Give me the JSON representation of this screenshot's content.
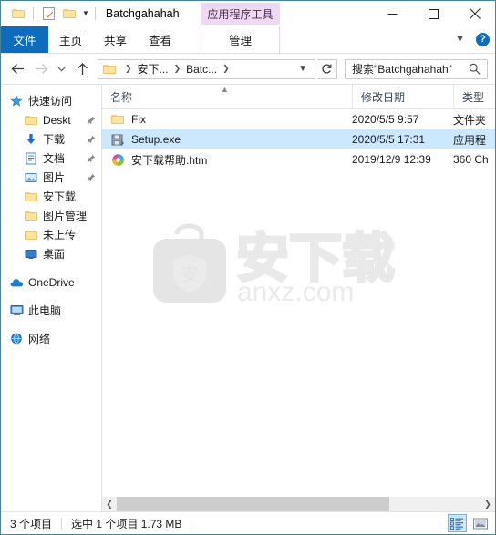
{
  "window": {
    "title": "Batchgahahah",
    "contextual_tab_group": "应用程序工具",
    "quick_access": [
      {
        "name": "folder-icon",
        "label": "属性文件夹"
      },
      {
        "name": "properties-icon",
        "label": "属性"
      },
      {
        "name": "new-folder-icon",
        "label": "新建文件夹"
      },
      {
        "name": "customize-caret",
        "label": "自定义快速访问工具栏"
      }
    ],
    "controls": {
      "minimize": "最小化",
      "maximize": "最大化",
      "close": "关闭"
    }
  },
  "ribbon": {
    "tabs": [
      {
        "label": "文件",
        "active": true
      },
      {
        "label": "主页",
        "active": false
      },
      {
        "label": "共享",
        "active": false
      },
      {
        "label": "查看",
        "active": false
      }
    ],
    "contextual_tab": {
      "label": "管理"
    },
    "collapse_label": "折叠功能区",
    "help_label": "?"
  },
  "addressbar": {
    "back": "后退",
    "forward": "前进",
    "recent": "最近浏览的位置",
    "up": "上移到",
    "breadcrumbs": [
      "安下...",
      "Batc..."
    ],
    "dropdown": "历史记录",
    "refresh": "刷新",
    "search": {
      "placeholder": "搜索\"Batchgahahah\"",
      "value": ""
    }
  },
  "sidebar": {
    "items": [
      {
        "label": "快速访问",
        "icon": "star-icon",
        "level": "root",
        "pinned": false
      },
      {
        "label": "Deskt",
        "icon": "folder-icon",
        "level": "child",
        "pinned": true
      },
      {
        "label": "下载",
        "icon": "download-icon",
        "level": "child",
        "pinned": true
      },
      {
        "label": "文档",
        "icon": "document-icon",
        "level": "child",
        "pinned": true
      },
      {
        "label": "图片",
        "icon": "pictures-icon",
        "level": "child",
        "pinned": true
      },
      {
        "label": "安下载",
        "icon": "folder-icon",
        "level": "child",
        "pinned": false
      },
      {
        "label": "图片管理",
        "icon": "folder-icon",
        "level": "child",
        "pinned": false
      },
      {
        "label": "未上传",
        "icon": "folder-icon",
        "level": "child",
        "pinned": false
      },
      {
        "label": "桌面",
        "icon": "desktop-icon",
        "level": "child",
        "pinned": false
      },
      {
        "label": "OneDrive",
        "icon": "cloud-icon",
        "level": "group",
        "pinned": false
      },
      {
        "label": "此电脑",
        "icon": "computer-icon",
        "level": "group",
        "pinned": false
      },
      {
        "label": "网络",
        "icon": "network-icon",
        "level": "group",
        "pinned": false
      }
    ]
  },
  "filelist": {
    "columns": [
      {
        "label": "名称",
        "sorted": "asc"
      },
      {
        "label": "修改日期",
        "sorted": ""
      },
      {
        "label": "类型",
        "sorted": ""
      }
    ],
    "rows": [
      {
        "name": "Fix",
        "date": "2020/5/5 9:57",
        "type": "文件夹",
        "icon": "folder-icon",
        "selected": false
      },
      {
        "name": "Setup.exe",
        "date": "2020/5/5 17:31",
        "type": "应用程",
        "icon": "installer-icon",
        "selected": true
      },
      {
        "name": "安下载帮助.htm",
        "date": "2019/12/9 12:39",
        "type": "360 Ch",
        "icon": "browser-icon",
        "selected": false
      }
    ],
    "watermark": {
      "text": "安下载",
      "sub": "anxz.com"
    }
  },
  "scrollbar": {
    "left_arrow": "向左滚动",
    "right_arrow": "向右滚动",
    "thumb_percent": 75
  },
  "statusbar": {
    "item_count": "3 个项目",
    "selection": "选中 1 个项目  1.73 MB",
    "views": [
      {
        "name": "details-view",
        "label": "详细信息",
        "active": true
      },
      {
        "name": "large-icons-view",
        "label": "大图标",
        "active": false
      }
    ]
  },
  "colors": {
    "accent": "#0f6cbd",
    "selection": "#cce8ff",
    "contextual": "#eed9f2",
    "window_border": "#4a8296"
  }
}
